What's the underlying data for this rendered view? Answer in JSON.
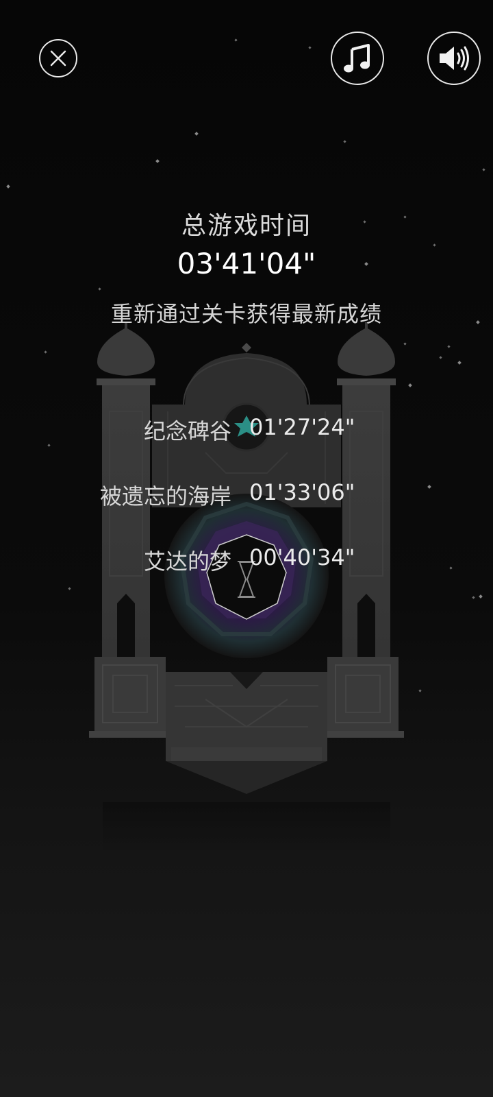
{
  "header": {
    "title": "总游戏时间",
    "total_time": "03'41'04\"",
    "subtitle": "重新通过关卡获得最新成绩"
  },
  "levels": [
    {
      "name": "纪念碑谷",
      "time": "01'27'24\""
    },
    {
      "name": "被遗忘的海岸",
      "time": "01'33'06\""
    },
    {
      "name": "艾达的梦",
      "time": "00'40'34\""
    }
  ],
  "icons": {
    "close": "close-icon",
    "music": "music-note-icon",
    "sound": "speaker-icon"
  },
  "colors": {
    "background": "#080808",
    "stone": "#3a3a3a",
    "accent_teal": "#2fa59a",
    "accent_purple": "#4a2f6e"
  }
}
